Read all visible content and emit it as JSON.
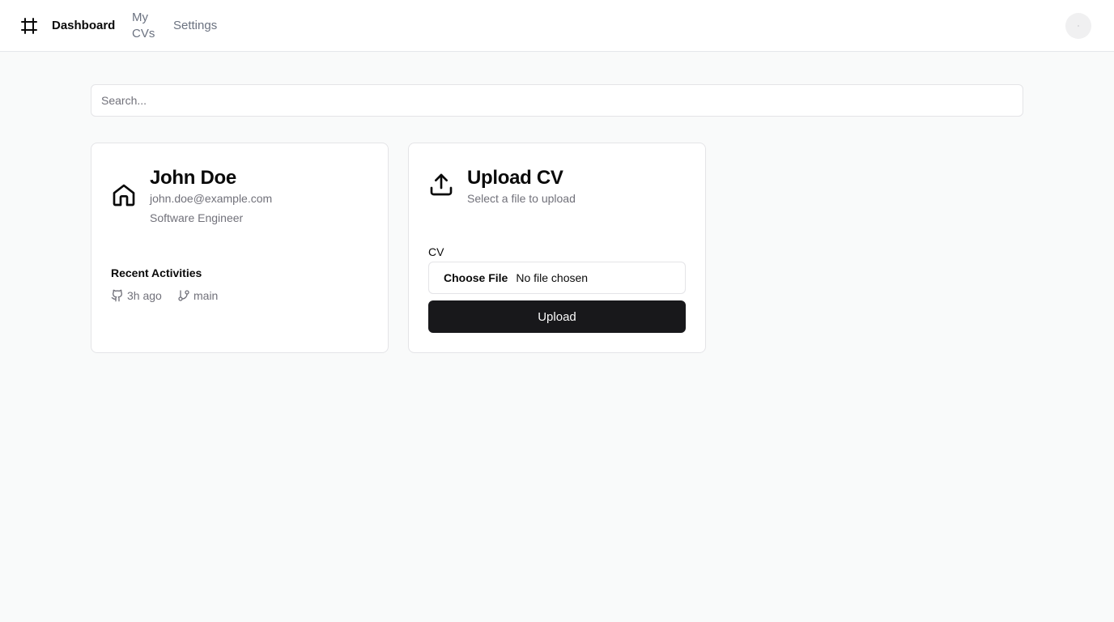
{
  "nav": {
    "logo_icon": "hash-icon",
    "items": [
      {
        "label": "Dashboard",
        "active": true
      },
      {
        "label": "My CVs",
        "active": false
      },
      {
        "label": "Settings",
        "active": false
      }
    ],
    "avatar_icon": "avatar"
  },
  "search": {
    "placeholder": "Search...",
    "value": ""
  },
  "profile": {
    "icon": "home-icon",
    "name": "John Doe",
    "email": "john.doe@example.com",
    "role": "Software Engineer",
    "activities_title": "Recent Activities",
    "activities": [
      {
        "icon": "github-icon",
        "text": "3h ago"
      },
      {
        "icon": "git-branch-icon",
        "text": "main"
      }
    ]
  },
  "upload": {
    "icon": "upload-icon",
    "title": "Upload CV",
    "subtitle": "Select a file to upload",
    "field_label": "CV",
    "choose_label": "Choose File",
    "file_status": "No file chosen",
    "button_label": "Upload"
  },
  "colors": {
    "background": "#f9fafa",
    "primary_button": "#18181b",
    "muted_text": "#71717a",
    "border": "#e4e4e7"
  }
}
